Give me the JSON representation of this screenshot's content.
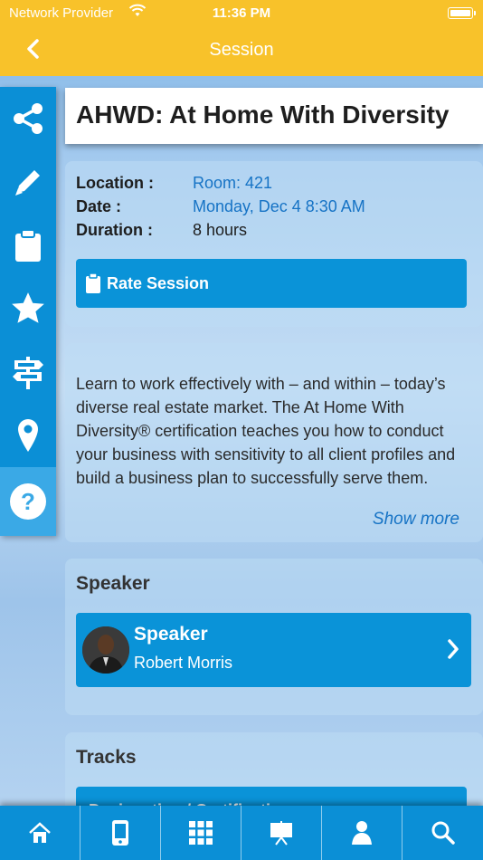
{
  "status_bar": {
    "carrier": "Network Provider",
    "time": "11:36 PM"
  },
  "header": {
    "title": "Session",
    "back_icon": "chevron-left-icon"
  },
  "sidebar": {
    "items": [
      {
        "icon": "share-icon"
      },
      {
        "icon": "pencil-icon"
      },
      {
        "icon": "clipboard-icon"
      },
      {
        "icon": "star-icon"
      },
      {
        "icon": "signpost-icon"
      },
      {
        "icon": "map-pin-icon"
      },
      {
        "icon": "help-icon",
        "active": true
      }
    ]
  },
  "session": {
    "title": "AHWD: At Home With Diversity",
    "location_label": "Location :",
    "location_value": "Room: 421",
    "date_label": "Date :",
    "date_value": "Monday, Dec 4 8:30 AM",
    "duration_label": "Duration :",
    "duration_value": "8 hours",
    "rate_label": "Rate Session"
  },
  "description": {
    "text": "Learn to work effectively with – and within – today’s diverse real estate market. The At Home With Diversity® certification teaches you how to conduct your business with sensitivity to all client profiles and build a business plan to successfully serve them.",
    "show_more": "Show more"
  },
  "speakers": {
    "section_title": "Speaker",
    "items": [
      {
        "role": "Speaker",
        "name": "Robert Morris"
      }
    ]
  },
  "tracks": {
    "section_title": "Tracks",
    "items": [
      "Designation / Certification"
    ]
  },
  "tabbar": {
    "items": [
      {
        "icon": "home-icon"
      },
      {
        "icon": "mobile-icon"
      },
      {
        "icon": "qr-grid-icon"
      },
      {
        "icon": "presentation-icon"
      },
      {
        "icon": "person-icon"
      },
      {
        "icon": "search-icon"
      }
    ]
  },
  "colors": {
    "header": "#f8c22a",
    "primary": "#0b8fd6",
    "link": "#1673c5"
  }
}
